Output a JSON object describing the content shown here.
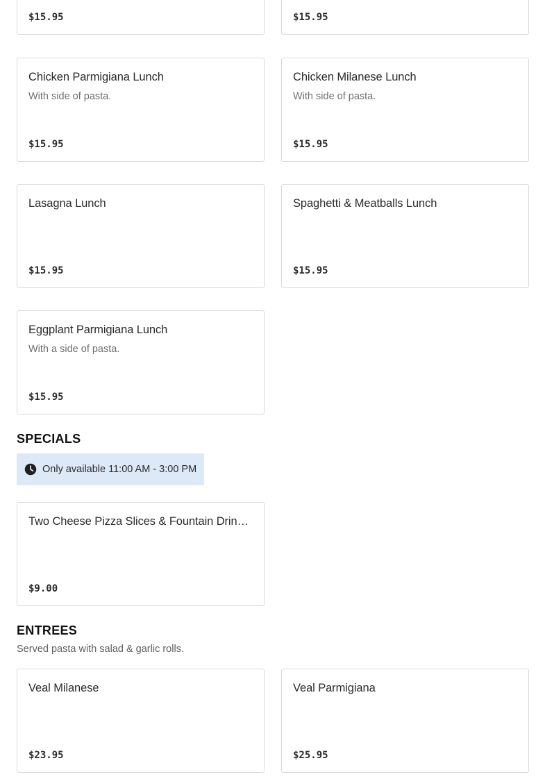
{
  "lunch_items": [
    {
      "name": "",
      "description": "",
      "price": "$15.95"
    },
    {
      "name": "",
      "description": "",
      "price": "$15.95"
    },
    {
      "name": "Chicken Parmigiana Lunch",
      "description": "With side of pasta.",
      "price": "$15.95"
    },
    {
      "name": "Chicken Milanese Lunch",
      "description": "With side of pasta.",
      "price": "$15.95"
    },
    {
      "name": "Lasagna Lunch",
      "description": "",
      "price": "$15.95"
    },
    {
      "name": "Spaghetti & Meatballs Lunch",
      "description": "",
      "price": "$15.95"
    },
    {
      "name": "Eggplant Parmigiana Lunch",
      "description": "With a side of pasta.",
      "price": "$15.95"
    }
  ],
  "specials": {
    "title": "SPECIALS",
    "availability": "Only available 11:00 AM - 3:00 PM",
    "items": [
      {
        "name": "Two Cheese Pizza Slices & Fountain Drink...",
        "description": "",
        "price": "$9.00"
      }
    ]
  },
  "entrees": {
    "title": "ENTREES",
    "subtitle": "Served pasta with salad & garlic rolls.",
    "items": [
      {
        "name": "Veal Milanese",
        "description": "",
        "price": "$23.95"
      },
      {
        "name": "Veal Parmigiana",
        "description": "",
        "price": "$25.95"
      }
    ]
  },
  "icons": {
    "availability": "clock-icon"
  },
  "colors": {
    "availability_bg": "#dde9f7",
    "card_border": "#d9d9d9"
  }
}
